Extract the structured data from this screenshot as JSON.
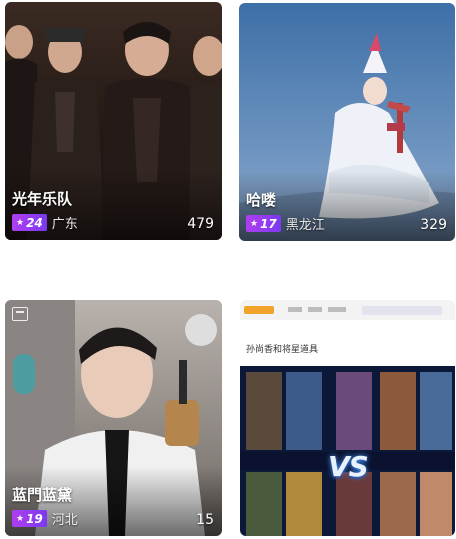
{
  "cards": [
    {
      "title": "光年乐队",
      "level": "24",
      "location": "广东",
      "count": "479",
      "star_icon": "star-icon",
      "badge_color": "#9b3cf0"
    },
    {
      "title": "哈喽",
      "level": "17",
      "location": "黑龙江",
      "count": "329",
      "star_icon": "star-icon",
      "badge_color": "#9b3cf0"
    },
    {
      "title": "蓝門蓝黛",
      "level": "19",
      "location": "河北",
      "count": "15",
      "star_icon": "star-icon",
      "badge_color": "#9b3cf0",
      "corner_icon": "screen-icon"
    },
    {
      "title": "",
      "stream_heading": "孙尚香和将星道具",
      "vs_label": "VS"
    }
  ]
}
